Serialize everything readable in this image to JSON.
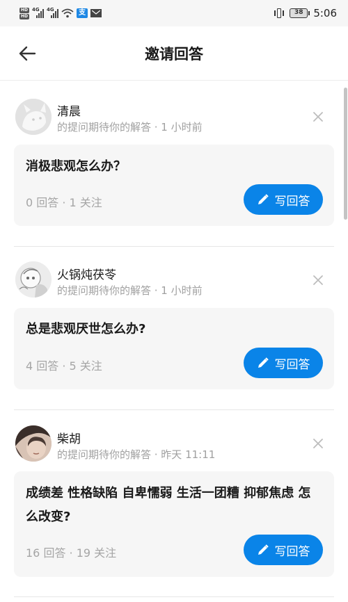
{
  "status_bar": {
    "sim_labels": [
      "HD",
      "HD"
    ],
    "network_labels": [
      "4G",
      "4G"
    ],
    "app_badge": "支",
    "battery": "38",
    "time": "5:06"
  },
  "header": {
    "title": "邀请回答"
  },
  "invitations": [
    {
      "name": "清晨",
      "meta": "的提问期待你的解答 · 1 小时前",
      "question": "消极悲观怎么办？",
      "stats": "0 回答 · 1 关注",
      "button_label": "写回答"
    },
    {
      "name": "火锅炖茯苓",
      "meta": "的提问期待你的解答 · 1 小时前",
      "question": "总是悲观厌世怎么办?",
      "stats": "4 回答 · 5 关注",
      "button_label": "写回答"
    },
    {
      "name": "柴胡",
      "meta": "的提问期待你的解答 · 昨天 11:11",
      "question": "成绩差 性格缺陷 自卑懦弱  生活一团糟  抑郁焦虑 怎么改变?",
      "stats": "16 回答 · 19 关注",
      "button_label": "写回答"
    }
  ],
  "colors": {
    "accent": "#0a84e8",
    "card_bg": "#f6f6f6",
    "muted_text": "#a0a0a0"
  }
}
